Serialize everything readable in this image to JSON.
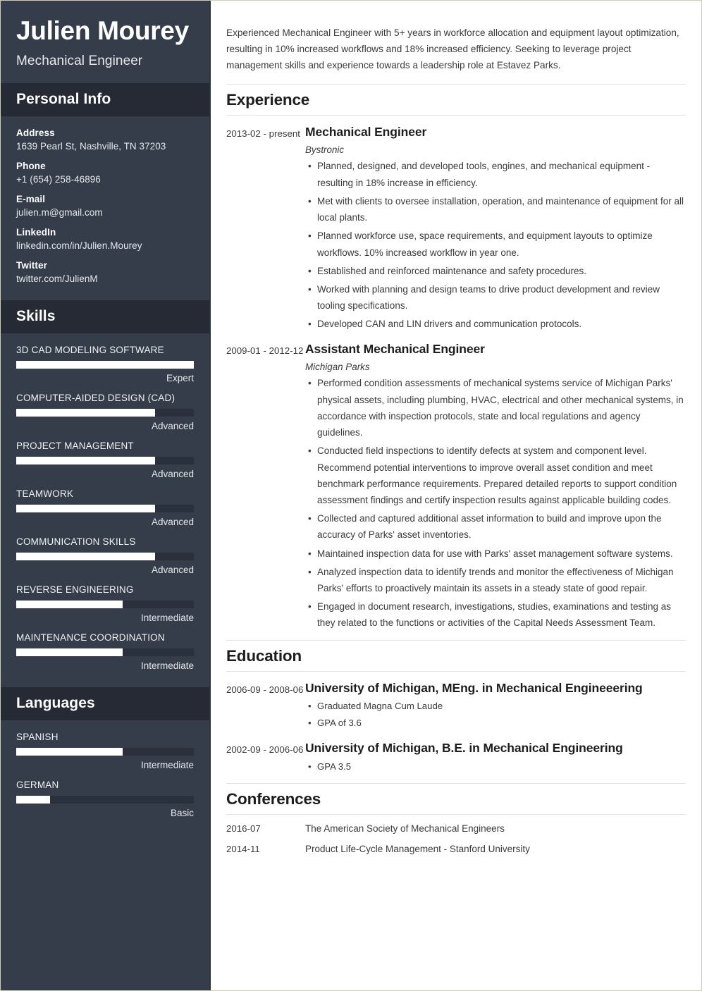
{
  "sidebar": {
    "name": "Julien Mourey",
    "job_title": "Mechanical Engineer",
    "personal_info": {
      "heading": "Personal Info",
      "items": [
        {
          "label": "Address",
          "value": "1639 Pearl St, Nashville, TN 37203"
        },
        {
          "label": "Phone",
          "value": "+1 (654) 258-46896"
        },
        {
          "label": "E-mail",
          "value": "julien.m@gmail.com"
        },
        {
          "label": "LinkedIn",
          "value": "linkedin.com/in/Julien.Mourey"
        },
        {
          "label": "Twitter",
          "value": "twitter.com/JulienM"
        }
      ]
    },
    "skills": {
      "heading": "Skills",
      "items": [
        {
          "name": "3D CAD MODELING SOFTWARE",
          "level": "Expert",
          "percent": 100
        },
        {
          "name": "COMPUTER-AIDED DESIGN (CAD)",
          "level": "Advanced",
          "percent": 78
        },
        {
          "name": "PROJECT MANAGEMENT",
          "level": "Advanced",
          "percent": 78
        },
        {
          "name": "TEAMWORK",
          "level": "Advanced",
          "percent": 78
        },
        {
          "name": "COMMUNICATION SKILLS",
          "level": "Advanced",
          "percent": 78
        },
        {
          "name": "REVERSE ENGINEERING",
          "level": "Intermediate",
          "percent": 60
        },
        {
          "name": "MAINTENANCE COORDINATION",
          "level": "Intermediate",
          "percent": 60
        }
      ]
    },
    "languages": {
      "heading": "Languages",
      "items": [
        {
          "name": "SPANISH",
          "level": "Intermediate",
          "percent": 60
        },
        {
          "name": "GERMAN",
          "level": "Basic",
          "percent": 19
        }
      ]
    }
  },
  "main": {
    "summary": "Experienced Mechanical Engineer with 5+ years in workforce allocation and equipment layout optimization, resulting in 10% increased workflows and 18% increased efficiency. Seeking to leverage project management skills and experience towards a leadership role at Estavez Parks.",
    "experience": {
      "heading": "Experience",
      "entries": [
        {
          "date": "2013-02 - present",
          "title": "Mechanical Engineer",
          "org": "Bystronic",
          "bullets": [
            "Planned, designed, and developed tools, engines, and mechanical equipment - resulting in 18% increase in efficiency.",
            "Met with clients to oversee installation, operation, and maintenance of equipment for all local plants.",
            "Planned workforce use, space requirements, and equipment layouts to optimize workflows. 10% increased workflow in year one.",
            "Established and reinforced maintenance and safety procedures.",
            "Worked with planning and design teams to drive product development and review tooling specifications.",
            "Developed CAN and LIN drivers and communication protocols."
          ]
        },
        {
          "date": "2009-01 - 2012-12",
          "title": "Assistant Mechanical Engineer",
          "org": "Michigan Parks",
          "bullets": [
            "Performed condition assessments of mechanical systems service of Michigan Parks' physical assets, including plumbing, HVAC, electrical and other mechanical systems, in accordance with inspection protocols, state and local regulations and agency guidelines.",
            "Conducted field inspections to identify defects at system and component level. Recommend potential interventions to improve overall asset condition and meet benchmark performance requirements. Prepared detailed reports to support condition assessment findings and certify inspection results against applicable building codes.",
            "Collected and captured additional asset information to build and improve upon the accuracy of Parks' asset inventories.",
            "Maintained inspection data for use with Parks' asset management software systems.",
            "Analyzed inspection data to identify trends and monitor the effectiveness of Michigan Parks' efforts to proactively maintain its assets in a steady state of good repair.",
            "Engaged in document research, investigations, studies, examinations and testing as they related to the functions or activities of the Capital Needs Assessment Team."
          ]
        }
      ]
    },
    "education": {
      "heading": "Education",
      "entries": [
        {
          "date": "2006-09 - 2008-06",
          "title": "University of Michigan, MEng. in Mechanical Engineeering",
          "bullets": [
            "Graduated Magna Cum Laude",
            "GPA of 3.6"
          ]
        },
        {
          "date": "2002-09 - 2006-06",
          "title": "University of Michigan, B.E. in Mechanical Engineering",
          "bullets": [
            "GPA 3.5"
          ]
        }
      ]
    },
    "conferences": {
      "heading": "Conferences",
      "entries": [
        {
          "date": "2016-07",
          "text": "The American Society of Mechanical Engineers"
        },
        {
          "date": "2014-11",
          "text": "Product Life-Cycle Management - Stanford University"
        }
      ]
    }
  }
}
